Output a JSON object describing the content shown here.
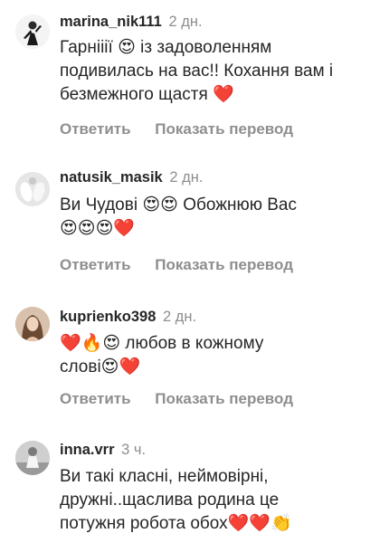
{
  "comments": [
    {
      "username": "marina_nik111",
      "time": "2 дн.",
      "text": "Гарнііії 😍 із задоволенням подивилась на вас!! Кохання вам і безмежного щастя ❤️",
      "reply_label": "Ответить",
      "translate_label": "Показать перевод"
    },
    {
      "username": "natusik_masik",
      "time": "2 дн.",
      "text": "Ви Чудові 😍😍 Обожнюю Вас\n😍😍😍❤️",
      "reply_label": "Ответить",
      "translate_label": "Показать перевод"
    },
    {
      "username": "kuprienko398",
      "time": "2 дн.",
      "text": "❤️🔥😍 любов в кожному\nслові😍❤️",
      "reply_label": "Ответить",
      "translate_label": "Показать перевод"
    },
    {
      "username": "inna.vrr",
      "time": "3 ч.",
      "text": "Ви такі класні, неймовірні,\nдружні..щаслива родина це\nпотужня робота обох❤️❤️👏",
      "reply_label": "",
      "translate_label": ""
    }
  ],
  "colors": {
    "text": "#262626",
    "muted": "#8e8e8e",
    "background": "#ffffff"
  }
}
